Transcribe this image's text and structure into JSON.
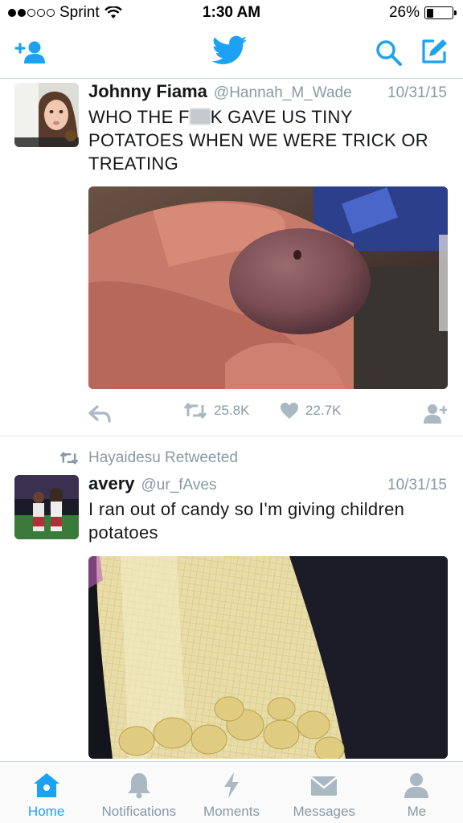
{
  "status_bar": {
    "carrier": "Sprint",
    "time": "1:30 AM",
    "battery_text": "26%",
    "battery_level": 0.26,
    "signal_bars_filled": 2,
    "signal_bars_total": 5
  },
  "nav": {
    "icons": [
      "add-user-icon",
      "twitter-bird-icon",
      "search-icon",
      "compose-icon"
    ]
  },
  "tweets": [
    {
      "name": "Johnny Fiama",
      "handle": "@Hannah_M_Wade",
      "date": "10/31/15",
      "text_before": "WHO THE F",
      "text_after": "K GAVE US TINY POTATOES WHEN WE WERE TRICK OR TREATING",
      "retweets": "25.8K",
      "likes": "22.7K"
    },
    {
      "retweet_context": "Hayaidesu Retweeted",
      "name": "avery",
      "handle": "@ur_fAves",
      "date": "10/31/15",
      "text": "I ran out of candy so I'm giving children potatoes"
    }
  ],
  "tabs": [
    {
      "label": "Home",
      "icon": "home-icon",
      "active": true
    },
    {
      "label": "Notifications",
      "icon": "bell-icon",
      "active": false
    },
    {
      "label": "Moments",
      "icon": "lightning-icon",
      "active": false
    },
    {
      "label": "Messages",
      "icon": "envelope-icon",
      "active": false
    },
    {
      "label": "Me",
      "icon": "person-icon",
      "active": false
    }
  ],
  "colors": {
    "accent": "#1da1f2",
    "secondary_text": "#8899a6",
    "icon_gray": "#aab8c2"
  }
}
